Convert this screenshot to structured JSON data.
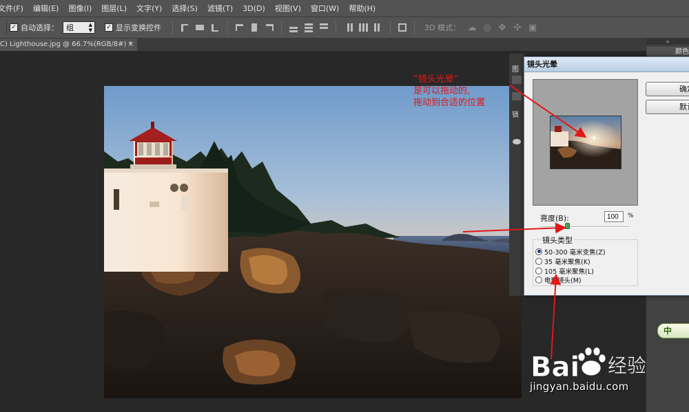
{
  "menu": [
    "文件(F)",
    "编辑(E)",
    "图像(I)",
    "图层(L)",
    "文字(Y)",
    "选择(S)",
    "滤镜(T)",
    "3D(D)",
    "视图(V)",
    "窗口(W)",
    "帮助(H)"
  ],
  "options": {
    "auto_select_label": "自动选择：",
    "auto_select_value": "组",
    "show_transform_label": "显示变换控件",
    "mode_3d_label": "3D 模式："
  },
  "document": {
    "tab_title": "C) Lighthouse.jpg @ 66.7%(RGB/8#) *",
    "close": "×"
  },
  "right_dock": {
    "collapse": "«",
    "tab_label": "颜色"
  },
  "mid_dock": {
    "label_1": "图",
    "label_2": "锁"
  },
  "dialog": {
    "title": "镜头光晕",
    "ok_label": "确定",
    "default_label": "默认",
    "brightness_label": "亮度(B):",
    "brightness_value": "100",
    "brightness_unit": "%",
    "brightness_level_pct": 100,
    "lens_type_title": "镜头类型",
    "lens_types": [
      {
        "label": "50-300 毫米变焦(Z)",
        "selected": true
      },
      {
        "label": "35 毫米聚焦(K)",
        "selected": false
      },
      {
        "label": "105 毫米聚焦(L)",
        "selected": false
      },
      {
        "label": "电影镜头(M)",
        "selected": false
      }
    ]
  },
  "annotation": {
    "line1": "“镜头光晕”",
    "line2": "是可以拖动的,",
    "line3": "拖动到合适的位置"
  },
  "watermark": {
    "url": "jingyan.baidu.com",
    "logo_text": "Bai",
    "logo_text2": "经验"
  },
  "ime": "中",
  "colors": {
    "ui_bg": "#535353",
    "canvas_bg": "#282828",
    "annotation": "#e01818"
  }
}
